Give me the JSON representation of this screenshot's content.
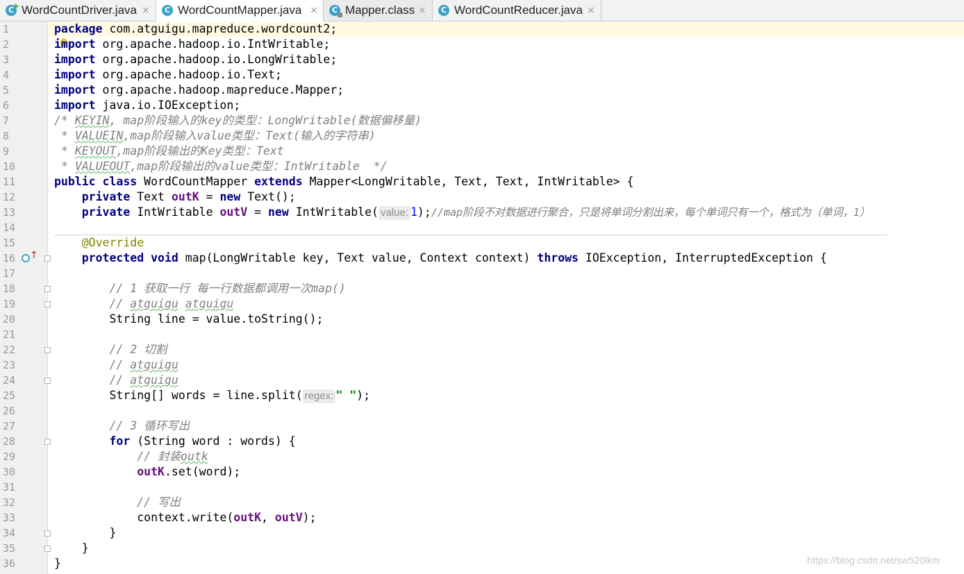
{
  "tabs": [
    {
      "label": "WordCountDriver.java",
      "icon": "class-run-icon",
      "close": "×"
    },
    {
      "label": "WordCountMapper.java",
      "icon": "class-icon",
      "close": "×"
    },
    {
      "label": "Mapper.class",
      "icon": "class-file-icon",
      "close": "×"
    },
    {
      "label": "WordCountReducer.java",
      "icon": "class-icon",
      "close": "×"
    }
  ],
  "editor": {
    "line_numbers": [
      "1",
      "2",
      "3",
      "4",
      "5",
      "6",
      "7",
      "8",
      "9",
      "10",
      "11",
      "12",
      "13",
      "14",
      "15",
      "16",
      "17",
      "18",
      "19",
      "20",
      "21",
      "22",
      "23",
      "24",
      "25",
      "26",
      "27",
      "28",
      "29",
      "30",
      "31",
      "32",
      "33",
      "34",
      "35",
      "36"
    ],
    "code": {
      "l1_kw": "package",
      "l1_rest": " com.atguigu.mapreduce.wordcount2;",
      "l2_kw": "import",
      "l2_rest": " org.apache.hadoop.io.IntWritable;",
      "l3_kw": "import",
      "l3_rest": " org.apache.hadoop.io.LongWritable;",
      "l4_kw": "import",
      "l4_rest": " org.apache.hadoop.io.Text;",
      "l5_kw": "import",
      "l5_rest": " org.apache.hadoop.mapreduce.Mapper;",
      "l6_kw": "import",
      "l6_rest": " java.io.IOException;",
      "l7_a": "/* ",
      "l7_b": "KEYIN",
      "l7_c": ", map阶段输入的key的类型：LongWritable(数据偏移量)",
      "l8_a": " * ",
      "l8_b": "VALUEIN",
      "l8_c": ",map阶段输入value类型：Text(输入的字符串)",
      "l9_a": " * ",
      "l9_b": "KEYOUT",
      "l9_c": ",map阶段输出的Key类型：Text",
      "l10_a": " * ",
      "l10_b": "VALUEOUT",
      "l10_c": ",map阶段输出的value类型：IntWritable  */",
      "l11_kw1": "public class",
      "l11_a": " WordCountMapper ",
      "l11_kw2": "extends",
      "l11_b": " Mapper<LongWritable, Text, Text, IntWritable> {",
      "l12_ind": "    ",
      "l12_kw": "private",
      "l12_a": " Text ",
      "l12_fld": "outK",
      "l12_b": " = ",
      "l12_kw2": "new",
      "l12_c": " Text();",
      "l13_ind": "    ",
      "l13_kw": "private",
      "l13_a": " IntWritable ",
      "l13_fld": "outV",
      "l13_b": " = ",
      "l13_kw2": "new",
      "l13_c": " IntWritable(",
      "l13_hint": "value:",
      "l13_num": "1",
      "l13_d": ");",
      "l13_com": "//map阶段不对数据进行聚合，只是将单词分割出来，每个单词只有一个，格式为（单词，1）",
      "l15_ind": "    ",
      "l15_ann": "@Override",
      "l16_ind": "    ",
      "l16_kw": "protected void",
      "l16_a": " map(LongWritable key, Text value, Context context) ",
      "l16_kw2": "throws",
      "l16_b": " IOException, InterruptedException {",
      "l18_ind": "        ",
      "l18_com": "// 1 获取一行 每一行数据都调用一次map()",
      "l19_ind": "        ",
      "l19_com_a": "// ",
      "l19_com_b": "atguigu",
      "l19_com_c": " ",
      "l19_com_d": "atguigu",
      "l20_ind": "        ",
      "l20_a": "String line = value.toString();",
      "l22_ind": "        ",
      "l22_com": "// 2 切割",
      "l23_ind": "        ",
      "l23_com_a": "// ",
      "l23_com_b": "atguigu",
      "l24_ind": "        ",
      "l24_com_a": "// ",
      "l24_com_b": "atguigu",
      "l25_ind": "        ",
      "l25_a": "String[] words = line.split(",
      "l25_hint": "regex:",
      "l25_str": "\" \"",
      "l25_b": ");",
      "l27_ind": "        ",
      "l27_com": "// 3 循环写出",
      "l28_ind": "        ",
      "l28_kw": "for",
      "l28_a": " (String word : words) {",
      "l29_ind": "            ",
      "l29_com_a": "// 封装",
      "l29_com_b": "outk",
      "l30_ind": "            ",
      "l30_fld": "outK",
      "l30_a": ".set(word);",
      "l32_ind": "            ",
      "l32_com": "// 写出",
      "l33_ind": "            ",
      "l33_a": "context.write(",
      "l33_fld1": "outK",
      "l33_b": ", ",
      "l33_fld2": "outV",
      "l33_c": ");",
      "l34_a": "        }",
      "l35_a": "    }",
      "l36_a": "}"
    }
  },
  "watermark": "https://blog.csdn.net/sw520lkm",
  "colors": {
    "keyword": "#000080",
    "field": "#660e7a",
    "comment": "#808080",
    "annotation": "#808000",
    "number": "#0000ff",
    "string": "#008000",
    "caret_line": "#fffae3"
  }
}
